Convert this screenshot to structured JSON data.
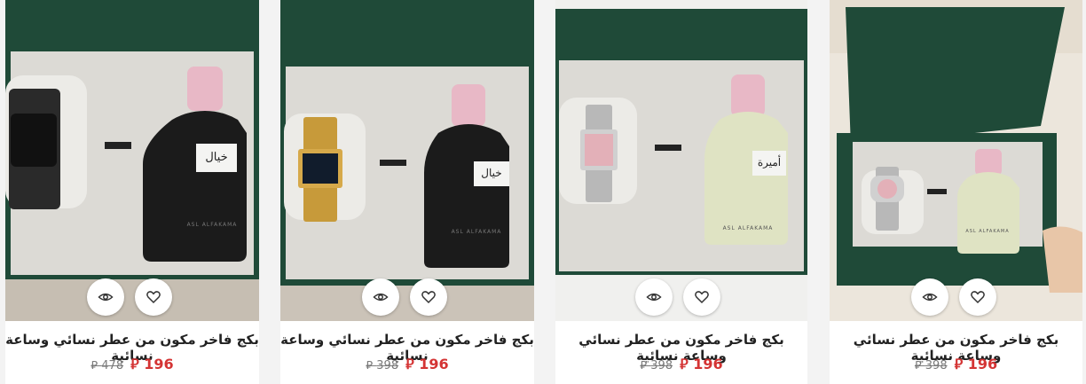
{
  "colors": {
    "box_green": "#1f4a38",
    "insert_grey": "#dcdad5",
    "price_red": "#d43434",
    "old_price_grey": "#7a7a7a",
    "bottle_black": "#1b1b1b",
    "bottle_clear": "#dfe3c3",
    "cap_pink": "#e8b8c6"
  },
  "icons": {
    "quick_view": "eye-icon",
    "wishlist": "heart-icon"
  },
  "products": [
    {
      "title": "بكج فاخر مكون من عطر نسائي وساعة نسائية",
      "price": "196 ⃁",
      "old_price": "478 ⃁",
      "bottle_label": "خيال",
      "bottle_brand": "ASL ALFAKAMA"
    },
    {
      "title": "بكج فاخر مكون من عطر نسائي وساعة نسائية",
      "price": "196 ⃁",
      "old_price": "398 ⃁",
      "bottle_label": "خيال",
      "bottle_brand": "ASL ALFAKAMA"
    },
    {
      "title": "بكج فاخر مكون من عطر نسائي وساعة نسائية",
      "price": "196 ⃁",
      "old_price": "398 ⃁",
      "bottle_label": "أميرة",
      "bottle_brand": "ASL ALFAKAMA"
    },
    {
      "title": "بكج فاخر مكون من عطر نسائي وساعة نسائية",
      "price": "196 ⃁",
      "old_price": "398 ⃁",
      "bottle_label": "",
      "bottle_brand": "ASL ALFAKAMA"
    }
  ]
}
